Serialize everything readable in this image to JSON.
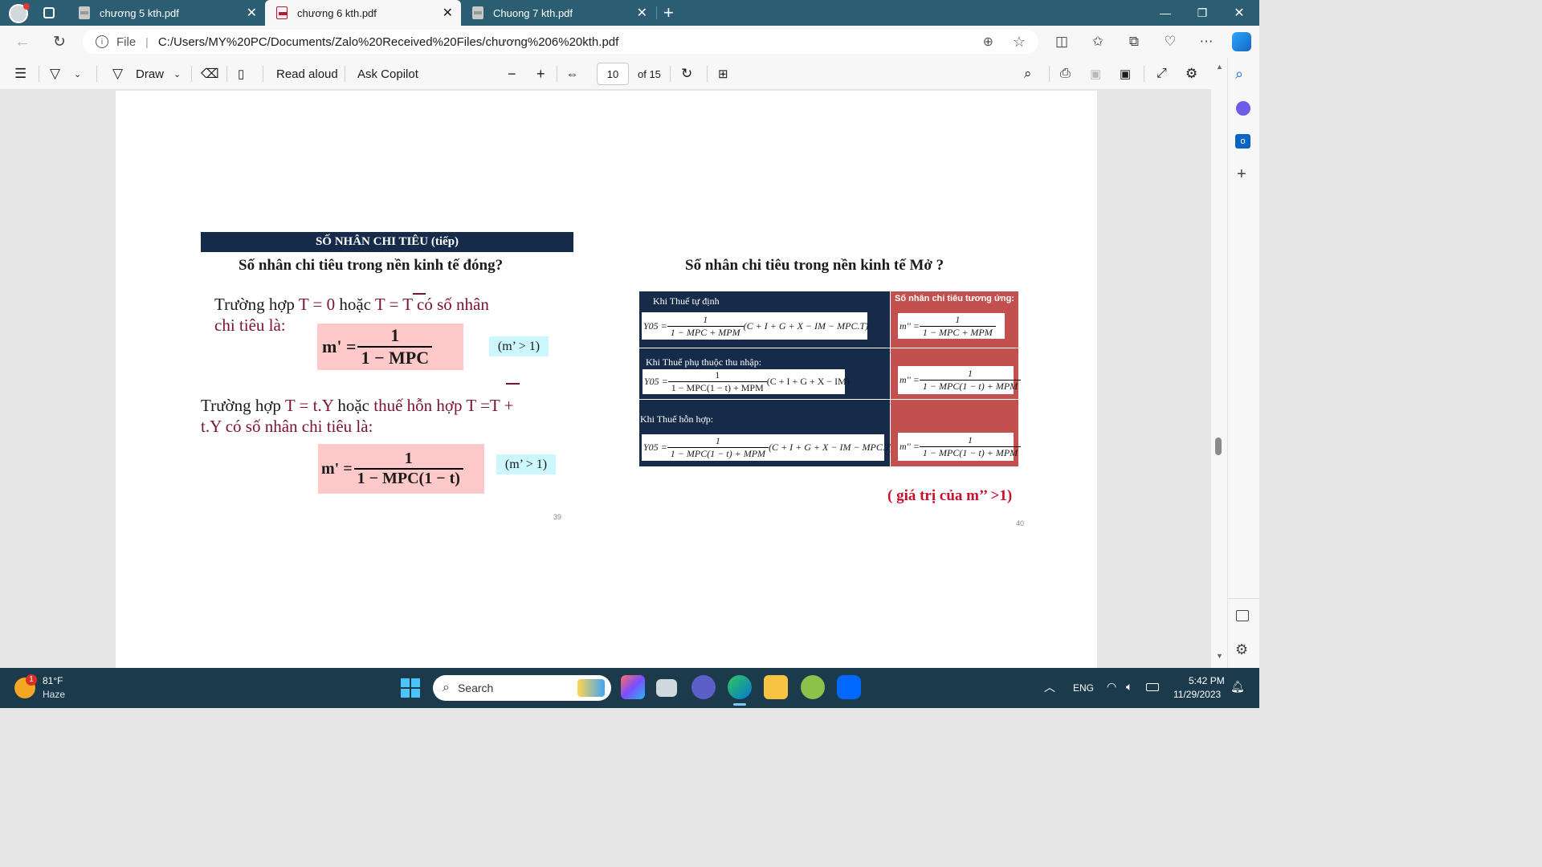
{
  "tabs": [
    {
      "label": "chương 5 kth.pdf",
      "active": false
    },
    {
      "label": "chương 6 kth.pdf",
      "active": true
    },
    {
      "label": "Chuong 7 kth.pdf",
      "active": false
    }
  ],
  "address": {
    "file_label": "File",
    "url": "C:/Users/MY%20PC/Documents/Zalo%20Received%20Files/chương%206%20kth.pdf"
  },
  "pdf_toolbar": {
    "draw_label": "Draw",
    "read_aloud_label": "Read aloud",
    "ask_copilot_label": "Ask Copilot",
    "page_number": "10",
    "page_total": "of 15"
  },
  "slide_left": {
    "header": "SỐ NHÂN CHI TIÊU (tiếp)",
    "subtitle": "Số nhân chi tiêu trong nền kinh tế đóng?",
    "case1_a": "Trường hợp",
    "case1_t0": "T = 0",
    "case1_or": "hoặc",
    "case1_tbar": "T = T",
    "case1_rest": "có số nhân",
    "case1_line2": "chi tiêu là:",
    "formula1_lhs": "m' =",
    "formula1_num": "1",
    "formula1_den": "1 − MPC",
    "cond1": "(m’ > 1)",
    "case2_a": "Trường hợp",
    "case2_t": "T = t.Y",
    "case2_or": "hoặc",
    "case2_rest": "thuế hỗn hợp",
    "case2_tt": "T =T +",
    "case2_line2": "t.Y có số nhân chi tiêu là:",
    "formula2_lhs": "m' =",
    "formula2_num": "1",
    "formula2_den": "1 − MPC(1 − t)",
    "cond2": "(m’ > 1)",
    "page_number": "39"
  },
  "slide_right": {
    "subtitle": "Số nhân chi tiêu trong nền kinh tế Mở ?",
    "col_header": "Số nhân chi tiêu tương ứng:",
    "rows": [
      {
        "label": "Khi Thuế tự định",
        "y": "Y05 =",
        "num": "1",
        "den": "1 − MPC + MPM",
        "paren": "(C + I + G + X − IM − MPC.T)",
        "m_lhs": "m'' =",
        "m_num": "1",
        "m_den": "1 − MPC + MPM"
      },
      {
        "label": "Khi Thuế phụ thuộc thu nhập:",
        "y": "Y05 =",
        "num": "1",
        "den": "1 − MPC(1 − t) + MPM",
        "paren": "(C + I + G + X − IM)",
        "m_lhs": "m'' =",
        "m_num": "1",
        "m_den": "1 − MPC(1 − t) + MPM"
      },
      {
        "label": "Khi Thuế hỗn hợp:",
        "y": "Y05 =",
        "num": "1",
        "den": "1 − MPC(1 − t) + MPM",
        "paren": "(C + I + G + X − IM − MPC.T)",
        "m_lhs": "m'' =",
        "m_num": "1",
        "m_den": "1 − MPC(1 − t) + MPM"
      }
    ],
    "note": "( giá trị của m’’ >1)",
    "page_number": "40"
  },
  "taskbar": {
    "weather_temp": "81°F",
    "weather_desc": "Haze",
    "weather_badge": "1",
    "search_label": "Search",
    "lang": "ENG",
    "time": "5:42 PM",
    "date": "11/29/2023"
  },
  "colors": {
    "tab_bar": "#2c5e73",
    "slide_header": "#162b4a",
    "maroon_text": "#7b1230",
    "red_cell": "#c2504e",
    "pink_box": "#ffc9c9",
    "cyan_box": "#ccf7ff"
  }
}
